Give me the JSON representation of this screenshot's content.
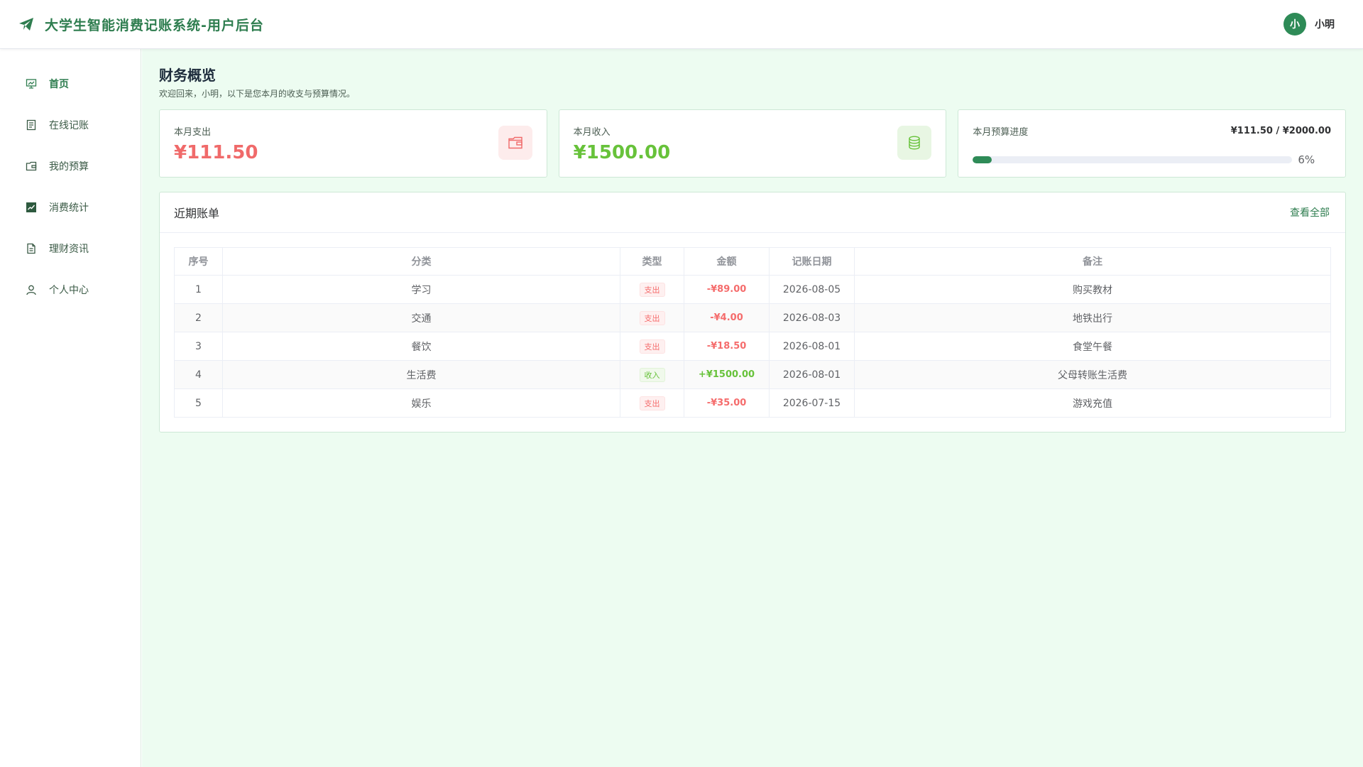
{
  "header": {
    "title": "大学生智能消费记账系统-用户后台",
    "avatar_text": "小",
    "username": "小明"
  },
  "sidebar": {
    "items": [
      {
        "label": "首页",
        "icon": "presentation-icon",
        "active": true
      },
      {
        "label": "在线记账",
        "icon": "document-icon",
        "active": false
      },
      {
        "label": "我的预算",
        "icon": "wallet-icon",
        "active": false
      },
      {
        "label": "消费统计",
        "icon": "chart-icon",
        "active": false
      },
      {
        "label": "理财资讯",
        "icon": "news-icon",
        "active": false
      },
      {
        "label": "个人中心",
        "icon": "user-icon",
        "active": false
      }
    ]
  },
  "main": {
    "title": "财务概览",
    "subtitle": "欢迎回来，小明，以下是您本月的收支与预算情况。",
    "cards": {
      "expense": {
        "label": "本月支出",
        "value": "¥111.50",
        "icon": "wallet-icon"
      },
      "income": {
        "label": "本月收入",
        "value": "¥1500.00",
        "icon": "coins-icon"
      },
      "budget": {
        "label": "本月预算进度",
        "amount": "¥111.50 / ¥2000.00",
        "percent_text": "6%",
        "percent": 6
      }
    },
    "bills": {
      "title": "近期账单",
      "view_all": "查看全部",
      "columns": [
        "序号",
        "分类",
        "类型",
        "金额",
        "记账日期",
        "备注"
      ],
      "rows": [
        {
          "no": "1",
          "category": "学习",
          "type": "支出",
          "kind": "out",
          "amount": "-¥89.00",
          "date": "2026-08-05",
          "note": "购买教材"
        },
        {
          "no": "2",
          "category": "交通",
          "type": "支出",
          "kind": "out",
          "amount": "-¥4.00",
          "date": "2026-08-03",
          "note": "地铁出行"
        },
        {
          "no": "3",
          "category": "餐饮",
          "type": "支出",
          "kind": "out",
          "amount": "-¥18.50",
          "date": "2026-08-01",
          "note": "食堂午餐"
        },
        {
          "no": "4",
          "category": "生活费",
          "type": "收入",
          "kind": "in",
          "amount": "+¥1500.00",
          "date": "2026-08-01",
          "note": "父母转账生活费"
        },
        {
          "no": "5",
          "category": "娱乐",
          "type": "支出",
          "kind": "out",
          "amount": "-¥35.00",
          "date": "2026-07-15",
          "note": "游戏充值"
        }
      ]
    }
  },
  "colors": {
    "brand": "#2e7d4f",
    "main_bg": "#edfcf1",
    "expense": "#f06a6a",
    "income": "#67c23a",
    "progress": "#2e8b57"
  }
}
